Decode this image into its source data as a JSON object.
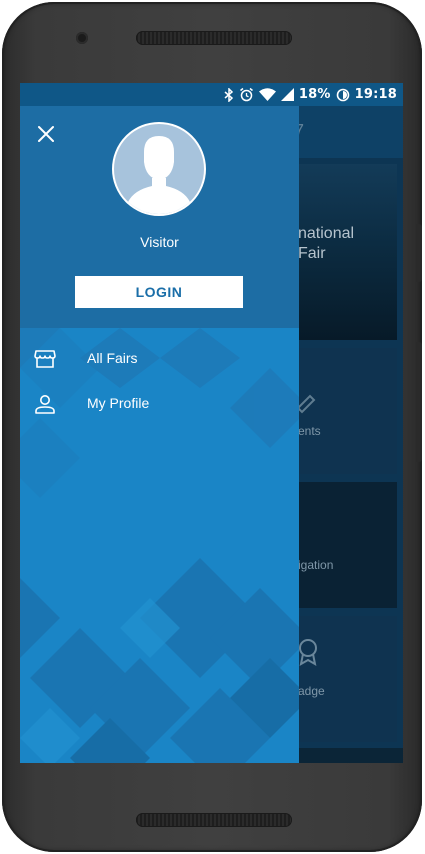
{
  "status_bar": {
    "battery": "18%",
    "time": "19:18"
  },
  "background_app": {
    "header_number": "7",
    "card1_title_line1": "national",
    "card1_title_line2": "Fair",
    "card2_label": "ents",
    "card3_label": "igation",
    "card4_label": "adge"
  },
  "drawer": {
    "user_name": "Visitor",
    "login_label": "LOGIN",
    "menu": [
      {
        "label": "All Fairs",
        "icon": "store-icon"
      },
      {
        "label": "My Profile",
        "icon": "person-icon"
      }
    ]
  },
  "colors": {
    "drawer_header": "#1d6da4",
    "drawer_body": "#1a85c6",
    "status_bar": "#0f5787",
    "login_text": "#1a6ea8"
  }
}
